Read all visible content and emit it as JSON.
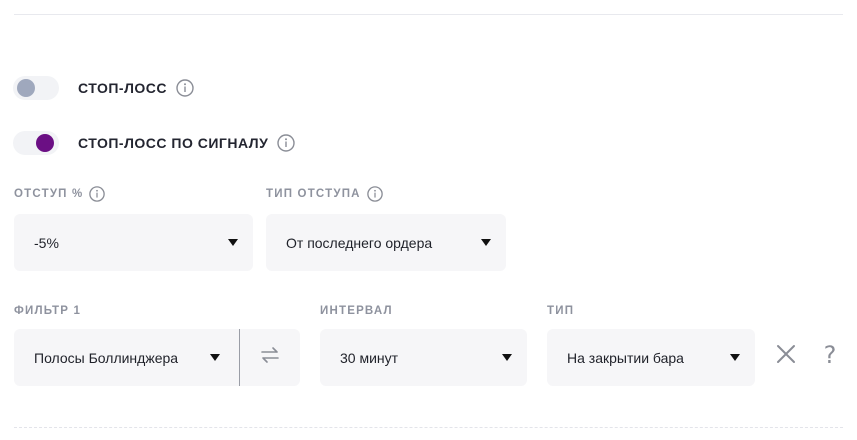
{
  "stop_loss": {
    "label": "СТОП-ЛОСС",
    "enabled": false
  },
  "signal_stop_loss": {
    "label": "СТОП-ЛОСС ПО СИГНАЛУ",
    "enabled": true
  },
  "offset": {
    "label": "ОТСТУП %",
    "value": "-5%"
  },
  "offset_type": {
    "label": "ТИП ОТСТУПА",
    "value": "От последнего ордера"
  },
  "filter": {
    "label": "ФИЛЬТР 1",
    "value": "Полосы Боллинджера"
  },
  "interval": {
    "label": "ИНТЕРВАЛ",
    "value": "30 минут"
  },
  "type": {
    "label": "ТИП",
    "value": "На закрытии бара"
  },
  "help": {
    "label": "?"
  },
  "colors": {
    "accent": "#6b0f84",
    "toggle_off_knob": "#9fa8bd",
    "field_bg": "#f6f6f8",
    "label_gray": "#8e929e"
  },
  "icons": [
    "info-icon",
    "chevron-down-icon",
    "swap-icon",
    "close-icon",
    "help-icon"
  ]
}
